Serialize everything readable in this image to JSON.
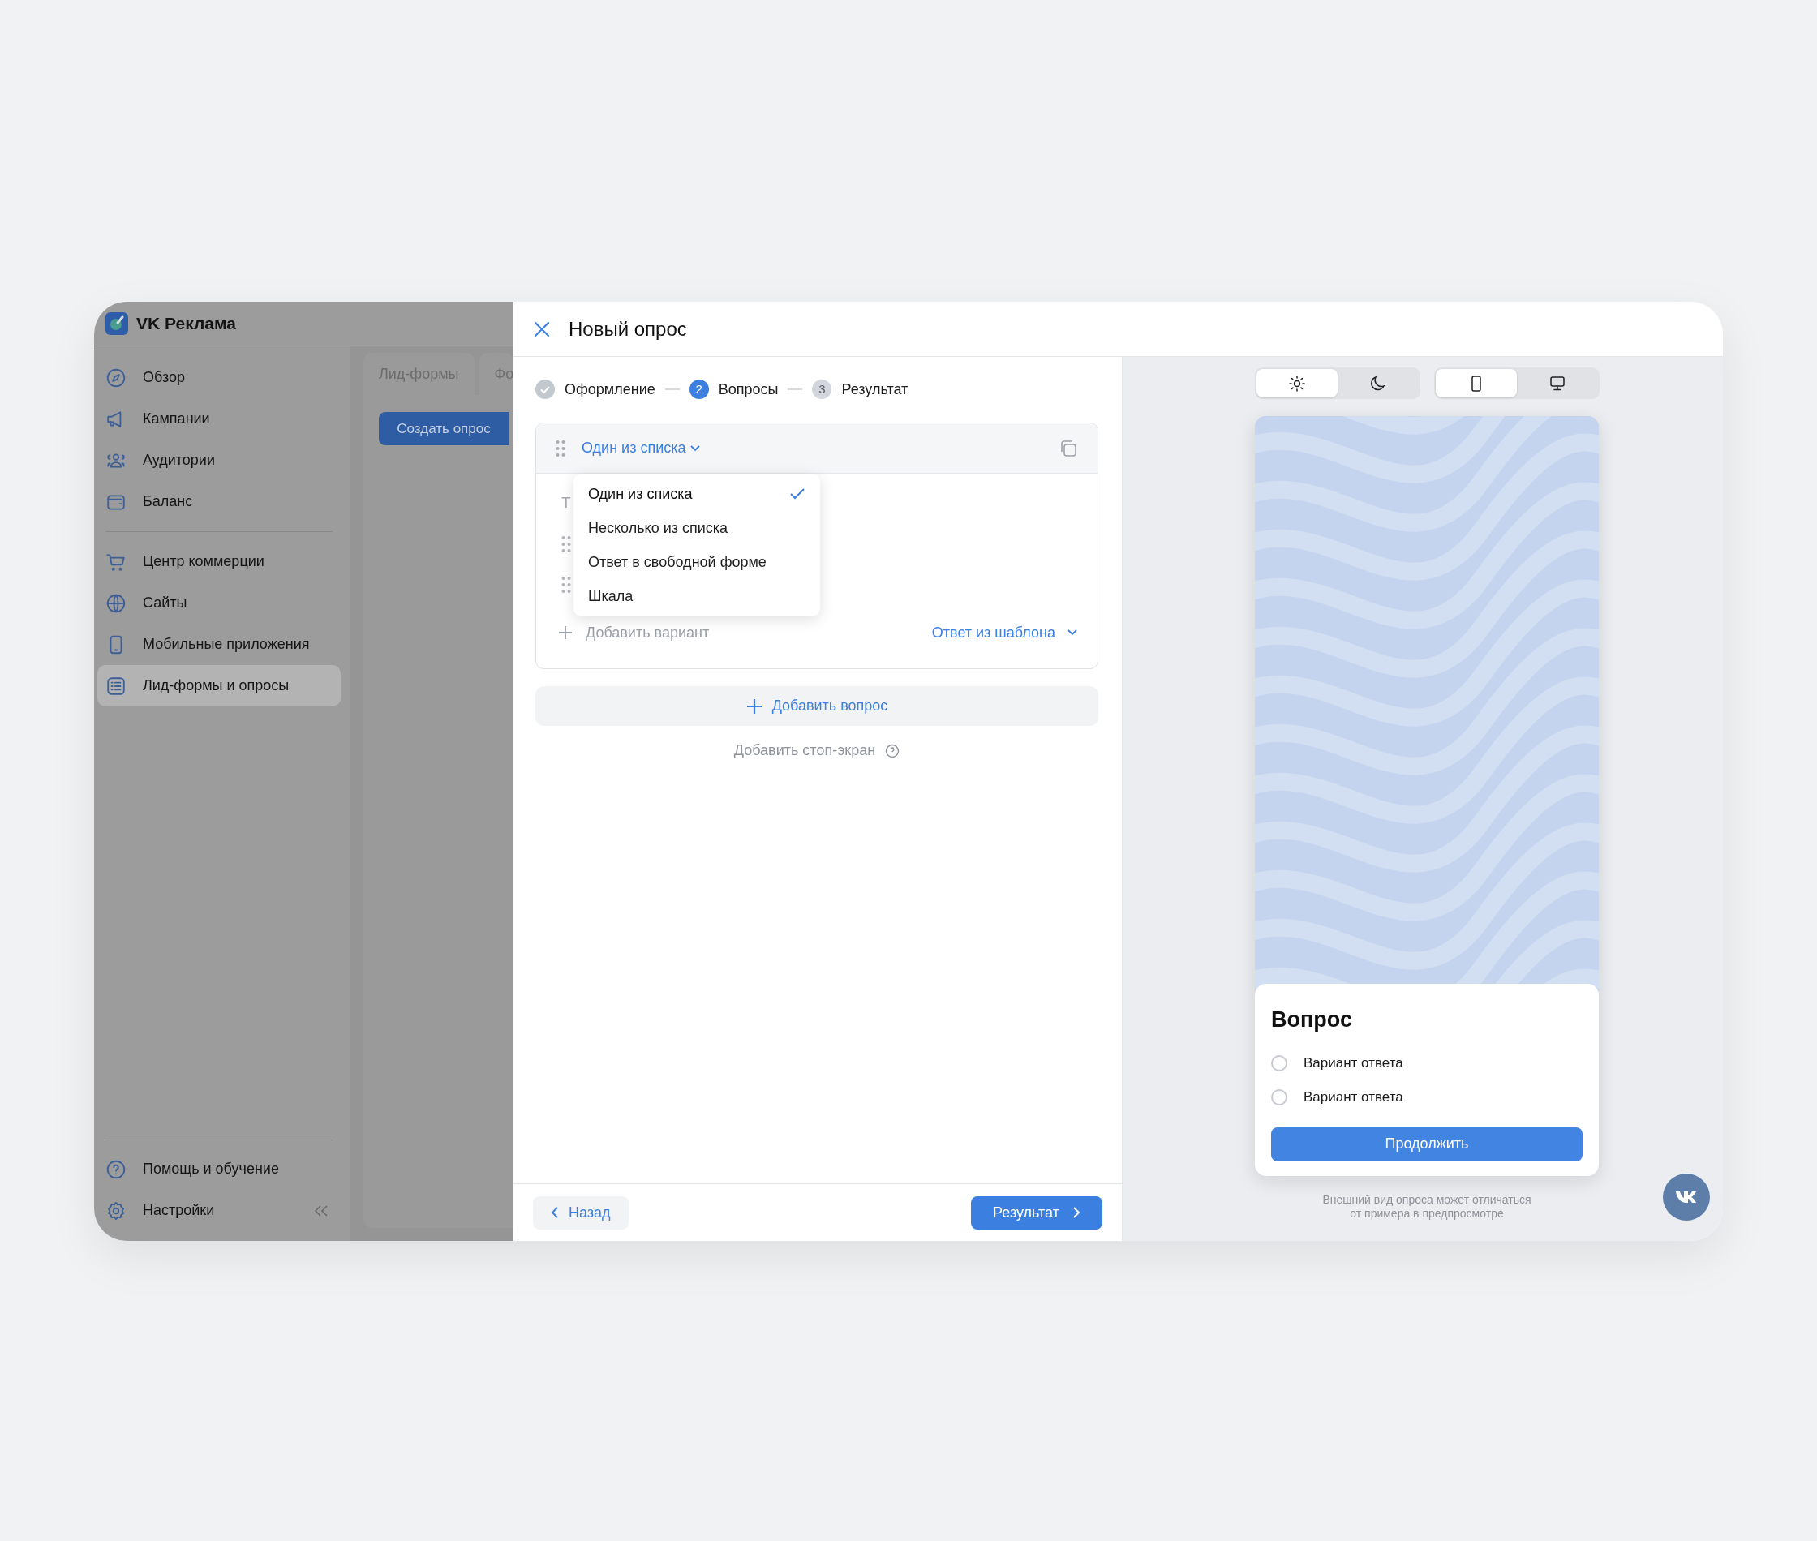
{
  "app": {
    "name": "VK Реклама"
  },
  "sidebar": {
    "items": [
      {
        "label": "Обзор",
        "selected": false
      },
      {
        "label": "Кампании",
        "selected": false
      },
      {
        "label": "Аудитории",
        "selected": false
      },
      {
        "label": "Баланс",
        "selected": false
      },
      {
        "label": "Центр коммерции",
        "selected": false
      },
      {
        "label": "Сайты",
        "selected": false
      },
      {
        "label": "Мобильные приложения",
        "selected": false
      },
      {
        "label": "Лид-формы и опросы",
        "selected": true
      }
    ],
    "bottom_items": [
      {
        "label": "Помощь и обучение"
      },
      {
        "label": "Настройки"
      }
    ]
  },
  "background_page": {
    "tabs": [
      {
        "label": "Лид-формы"
      },
      {
        "label": "Фо"
      }
    ],
    "create_button": "Создать опрос"
  },
  "modal": {
    "title": "Новый опрос",
    "steps": [
      {
        "completed": true,
        "selected": false,
        "label": "Оформление"
      },
      {
        "completed": false,
        "selected": true,
        "number": "2",
        "label": "Вопросы"
      },
      {
        "completed": false,
        "selected": false,
        "number": "3",
        "label": "Результат"
      }
    ],
    "question": {
      "type_label": "Один из списка",
      "text_placeholder": "Т",
      "option_rows": [
        {
          "kind": "option"
        },
        {
          "kind": "option"
        }
      ],
      "add_option": "Добавить вариант",
      "template": "Ответ из шаблона"
    },
    "type_menu": [
      {
        "label": "Один из списка",
        "selected": true
      },
      {
        "label": "Несколько из списка",
        "selected": false
      },
      {
        "label": "Ответ в свободной форме",
        "selected": false
      },
      {
        "label": "Шкала",
        "selected": false
      }
    ],
    "add_question": "Добавить вопрос",
    "stop_screen": "Добавить стоп-экран",
    "back": "Назад",
    "next": "Результат"
  },
  "preview": {
    "theme": [
      {
        "kind": "light",
        "selected": true
      },
      {
        "kind": "dark",
        "selected": false
      }
    ],
    "device": [
      {
        "kind": "mobile",
        "selected": true
      },
      {
        "kind": "desktop",
        "selected": false
      }
    ],
    "card": {
      "title": "Вопрос",
      "options": [
        {
          "label": "Вариант ответа",
          "selected": false
        },
        {
          "label": "Вариант ответа",
          "selected": false
        }
      ],
      "button": "Продолжить"
    },
    "note": "Внешний вид опроса может отличаться\nот примера в предпросмотре"
  }
}
